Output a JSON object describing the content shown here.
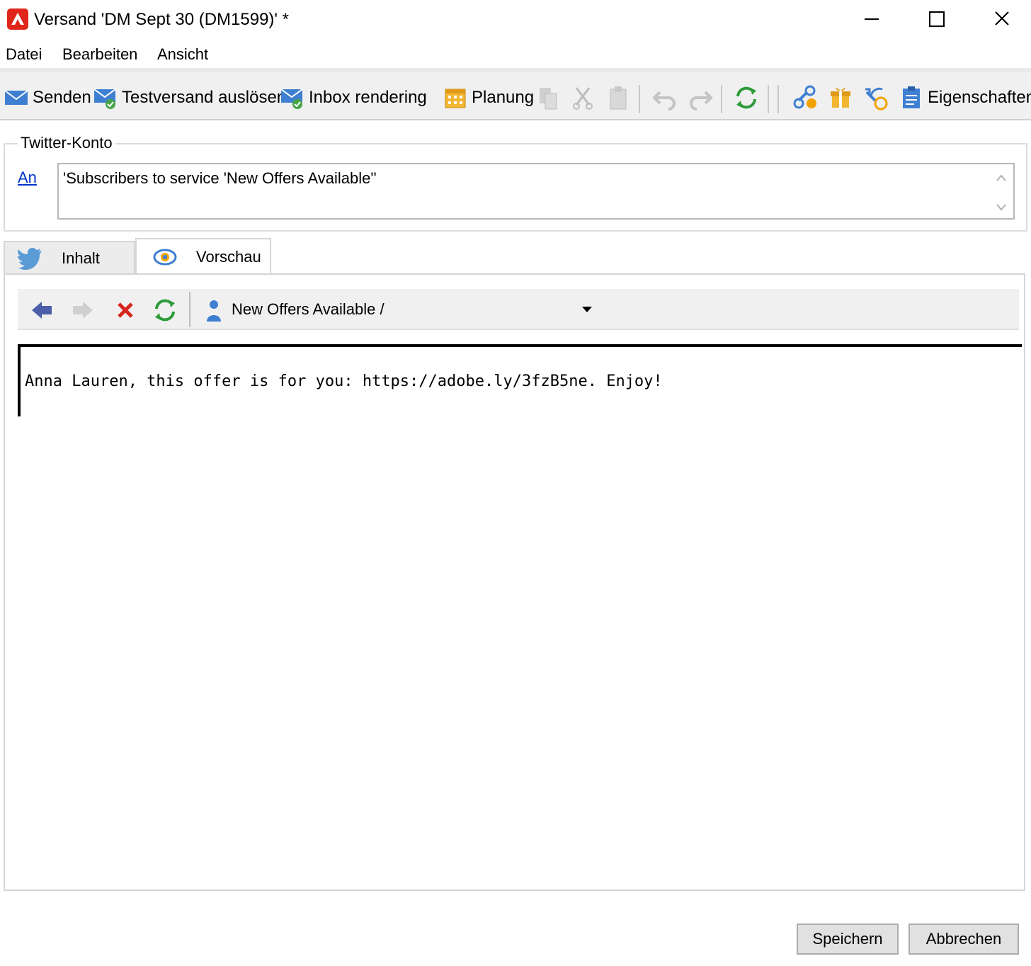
{
  "window": {
    "title": "Versand 'DM Sept 30 (DM1599)' *",
    "app_icon": "adobe-campaign-icon",
    "controls": [
      "minimize-icon",
      "maximize-icon",
      "close-icon"
    ]
  },
  "menu": {
    "items": [
      "Datei",
      "Bearbeiten",
      "Ansicht"
    ]
  },
  "toolbar": {
    "send_label": "Senden",
    "test_label": "Testversand auslösen",
    "inbox_label": "Inbox rendering",
    "schedule_label": "Planung",
    "properties_label": "Eigenschaften"
  },
  "account": {
    "legend": "Twitter-Konto",
    "to_label": "An",
    "to_value": "'Subscribers to service 'New Offers Available''"
  },
  "tabs": {
    "content_label": "Inhalt",
    "preview_label": "Vorschau"
  },
  "preview": {
    "selected_target": "New Offers Available /",
    "message": "Anna Lauren, this offer is for you: https://adobe.ly/3fzB5ne. Enjoy!"
  },
  "buttons": {
    "save_label": "Speichern",
    "cancel_label": "Abbrechen"
  },
  "colors": {
    "app_icon": "#e0251b",
    "link": "#0033cc",
    "toolbar_bg": "#f0f0f0",
    "twitter_blue": "#5b9bd5",
    "refresh_green": "#2e9b3a"
  }
}
